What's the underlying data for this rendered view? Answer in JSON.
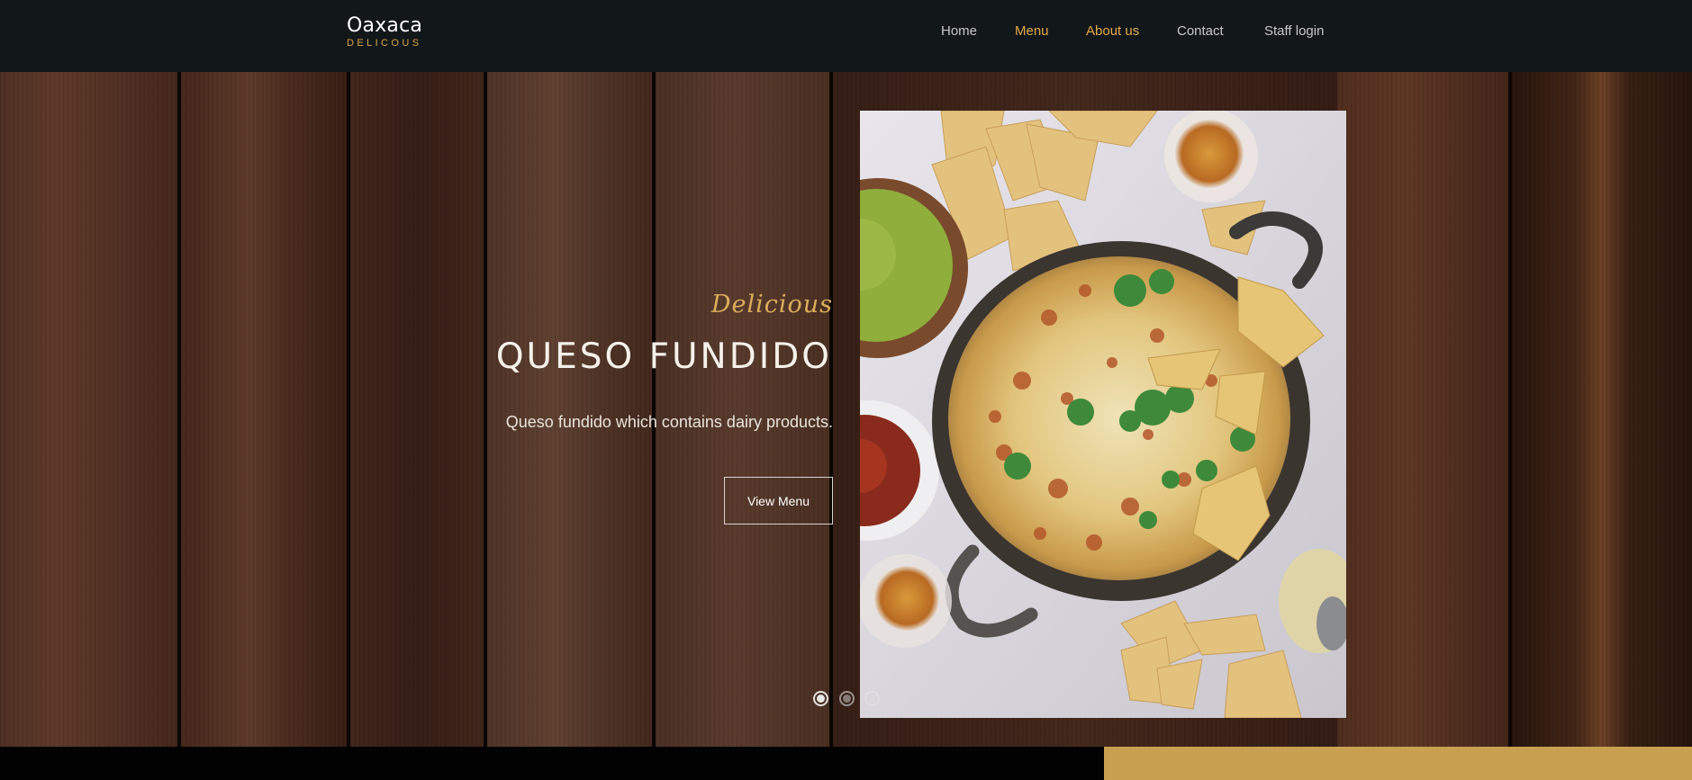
{
  "brand": {
    "name": "Oaxaca",
    "tagline": "DELICOUS"
  },
  "nav": {
    "items": [
      {
        "label": "Home",
        "active": false
      },
      {
        "label": "Menu",
        "active": true
      },
      {
        "label": "About us",
        "active": true
      },
      {
        "label": "Contact",
        "active": false
      },
      {
        "label": "Staff login",
        "active": false
      }
    ]
  },
  "hero": {
    "tagline": "Delicious",
    "title": "QUESO FUNDIDO",
    "description": "Queso fundido which contains dairy products.",
    "button_label": "View Menu",
    "image_alt": "Queso fundido in a skillet with tortilla chips, guacamole, salsa and drinks",
    "slides": {
      "count": 3,
      "active_index": 0
    }
  },
  "colors": {
    "header_bg": "#12171a",
    "accent_gold": "#e3a948",
    "nav_text": "#c8c8c8",
    "footer_gold": "#c9a050",
    "footer_black": "#020202"
  }
}
